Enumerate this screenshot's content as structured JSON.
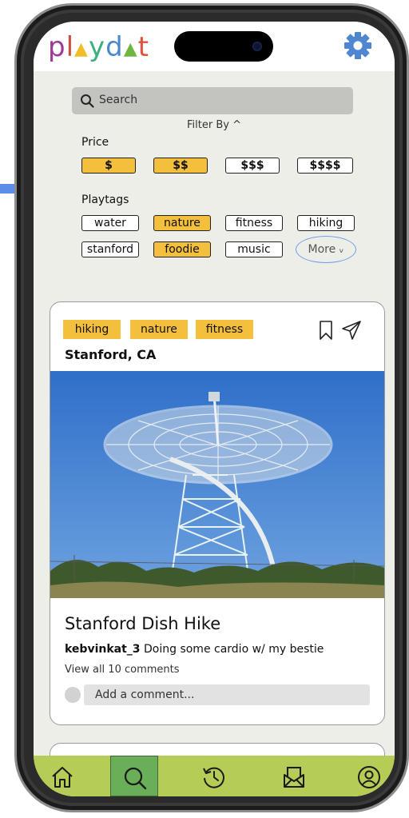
{
  "app": {
    "logo_letters": [
      {
        "ch": "p",
        "color": "#9d3a97"
      },
      {
        "ch": "l",
        "color": "#c84f3f"
      },
      {
        "ch": "▲",
        "color": "#f2bd2a"
      },
      {
        "ch": "y",
        "color": "#3ab07f"
      },
      {
        "ch": "d",
        "color": "#4a88c9"
      },
      {
        "ch": "▲",
        "color": "#6fb53e"
      },
      {
        "ch": "t",
        "color": "#e0503c"
      }
    ],
    "settings_icon": "gear-icon",
    "accent": "#4f86d1"
  },
  "search": {
    "placeholder": "Search",
    "icon": "search-icon"
  },
  "filters": {
    "toggle_label": "Filter By ^",
    "price_label": "Price",
    "price_options": [
      {
        "label": "$",
        "selected": true
      },
      {
        "label": "$$",
        "selected": true
      },
      {
        "label": "$$$",
        "selected": false
      },
      {
        "label": "$$$$",
        "selected": false
      }
    ],
    "playtags_label": "Playtags",
    "playtags": [
      {
        "label": "water",
        "selected": false
      },
      {
        "label": "nature",
        "selected": true
      },
      {
        "label": "fitness",
        "selected": false
      },
      {
        "label": "hiking",
        "selected": false
      },
      {
        "label": "stanford",
        "selected": false
      },
      {
        "label": "foodie",
        "selected": true
      },
      {
        "label": "music",
        "selected": false
      }
    ],
    "more_label": "More ᵥ"
  },
  "post": {
    "tags": [
      "hiking",
      "nature",
      "fitness"
    ],
    "location": "Stanford, CA",
    "title": "Stanford Dish Hike",
    "username": "kebvinkat_3",
    "caption": "Doing some cardio w/ my bestie",
    "comments_link": "View all 10 comments",
    "comment_placeholder": "Add a comment...",
    "icons": [
      "bookmark-icon",
      "send-icon"
    ]
  },
  "tabbar": {
    "items": [
      {
        "icon": "home-icon",
        "active": false
      },
      {
        "icon": "search-icon",
        "active": true
      },
      {
        "icon": "history-icon",
        "active": false
      },
      {
        "icon": "inbox-icon",
        "active": false
      },
      {
        "icon": "profile-icon",
        "active": false
      }
    ],
    "colors": {
      "bar": "#b5cd56",
      "active": "#6aae57"
    }
  },
  "colors": {
    "tag_yellow": "#f4bf3c",
    "screen_bg": "#edeee7",
    "arrow_blue": "#5b8ee6"
  }
}
